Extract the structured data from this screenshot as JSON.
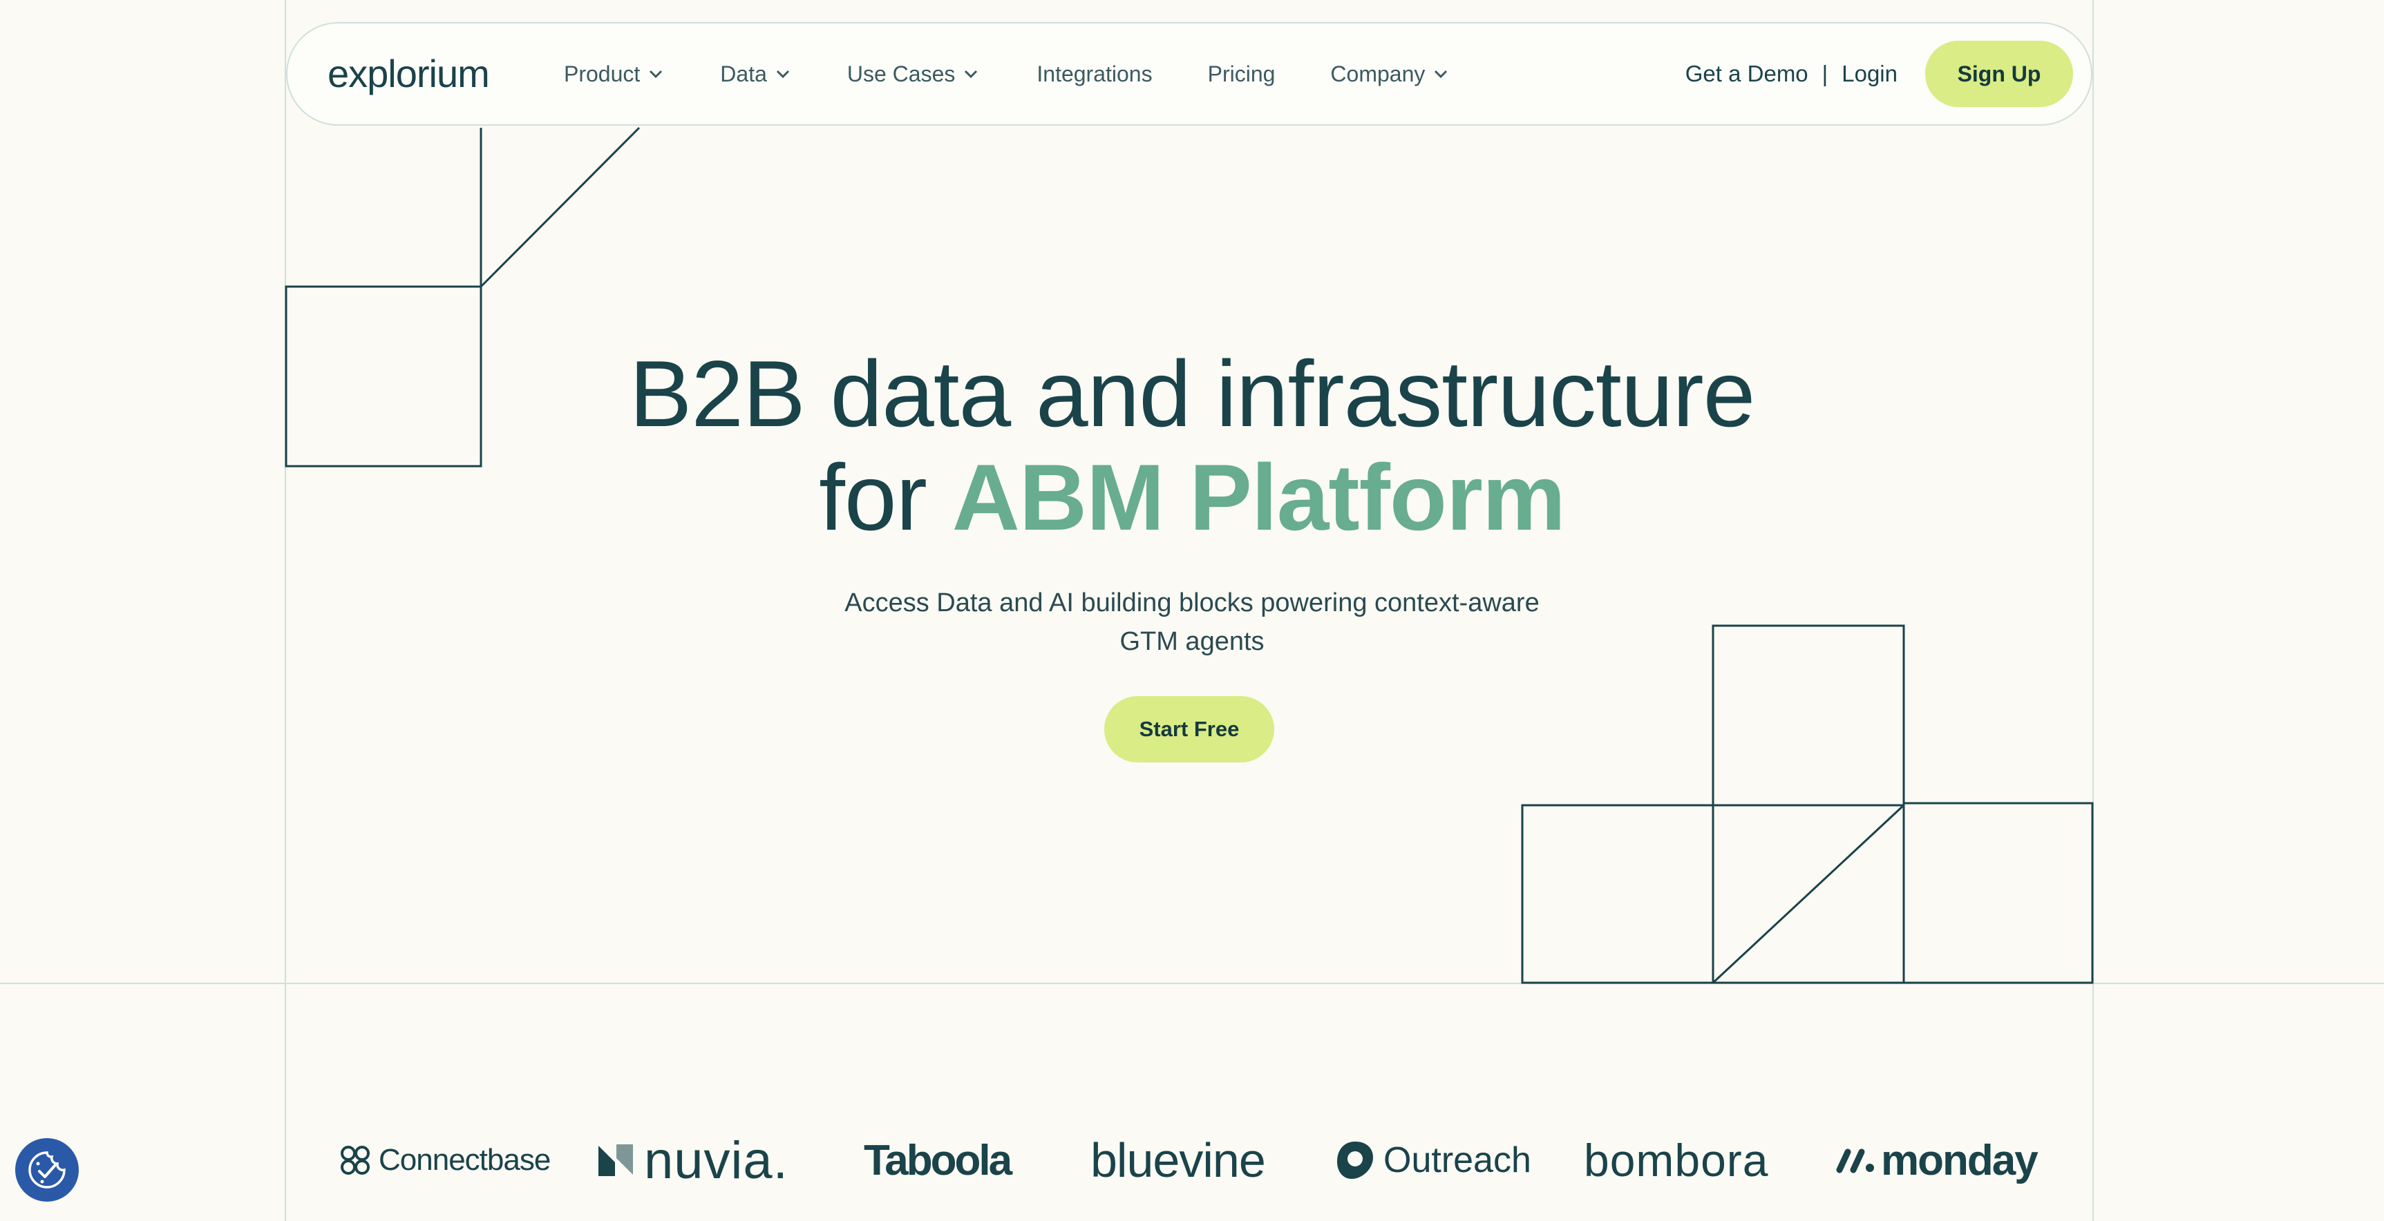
{
  "colors": {
    "background": "#fbfaf4",
    "primary_text": "#1a434a",
    "accent_green": "#67ad8e",
    "button_lime": "#d9ec85",
    "frame_line": "#cfe0de",
    "cookie_blue": "#2a59a8"
  },
  "nav": {
    "logo": "explorium",
    "items": [
      {
        "label": "Product",
        "has_dropdown": true
      },
      {
        "label": "Data",
        "has_dropdown": true
      },
      {
        "label": "Use Cases",
        "has_dropdown": true
      },
      {
        "label": "Integrations",
        "has_dropdown": false
      },
      {
        "label": "Pricing",
        "has_dropdown": false
      },
      {
        "label": "Company",
        "has_dropdown": true
      }
    ],
    "get_demo": "Get a Demo",
    "separator": "|",
    "login": "Login",
    "signup": "Sign Up"
  },
  "hero": {
    "title_line1": "B2B data and infrastructure",
    "title_line2_prefix": "for",
    "title_line2_accent": "ABM Platform",
    "subtitle_line1": "Access Data and AI building blocks powering context-aware",
    "subtitle_line2": "GTM agents",
    "cta": "Start Free"
  },
  "customer_logos": [
    "Connectbase",
    "nuvia.",
    "Taboola",
    "bluevine",
    "Outreach",
    "bombora",
    "monday"
  ],
  "icons": {
    "nav_dropdown": "chevron-down-icon",
    "cookie_settings": "cookie-consent-icon"
  }
}
